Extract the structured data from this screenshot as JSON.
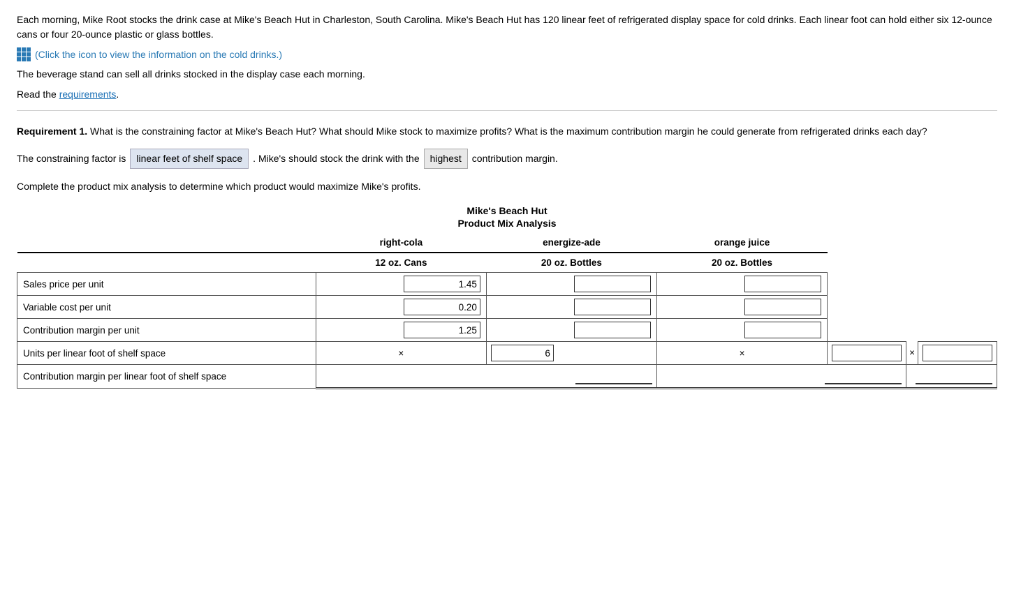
{
  "intro": {
    "paragraph": "Each morning, Mike Root stocks the drink case at Mike's Beach Hut in Charleston, South Carolina. Mike's Beach Hut has 120 linear feet of refrigerated display space for cold drinks. Each linear foot can hold either six 12-ounce cans or four 20-ounce plastic or glass bottles.",
    "click_note": "(Click the icon to view the information on the cold drinks.)",
    "beverage": "The beverage stand can sell all drinks stocked in the display case each morning.",
    "read_req_prefix": "Read the ",
    "read_req_link": "requirements",
    "read_req_suffix": "."
  },
  "requirement1": {
    "label": "Requirement 1.",
    "text": " What is the constraining factor at Mike's Beach Hut? What should Mike stock to maximize profits? What is the maximum contribution margin he could generate from refrigerated drinks each day?",
    "constraining_prefix": "The constraining factor is",
    "constraining_value": "linear feet of shelf space",
    "constraining_mid": ". Mike's should stock the drink with the",
    "constraining_highlight": "highest",
    "constraining_suffix": "contribution margin.",
    "complete_text": "Complete the product mix analysis to determine which product would maximize Mike's profits."
  },
  "table": {
    "title": "Mike's Beach Hut",
    "subtitle": "Product Mix Analysis",
    "columns": [
      {
        "name": "right-cola",
        "sub": "12 oz. Cans"
      },
      {
        "name": "energize-ade",
        "sub": "20 oz. Bottles"
      },
      {
        "name": "orange juice",
        "sub": "20 oz. Bottles"
      }
    ],
    "rows": [
      {
        "label": "Sales price per unit",
        "values": [
          "1.45",
          "",
          ""
        ],
        "prefix": [
          "",
          "",
          ""
        ],
        "suffix": [
          "",
          "",
          ""
        ]
      },
      {
        "label": "Variable cost per unit",
        "values": [
          "0.20",
          "",
          ""
        ],
        "prefix": [
          "",
          "",
          ""
        ],
        "suffix": [
          "",
          "",
          ""
        ]
      },
      {
        "label": "Contribution margin per unit",
        "values": [
          "1.25",
          "",
          ""
        ],
        "prefix": [
          "",
          "",
          ""
        ],
        "suffix": [
          "",
          "",
          ""
        ]
      },
      {
        "label": "Units per linear foot of shelf space",
        "values": [
          "6",
          "",
          ""
        ],
        "prefix": [
          "×",
          "×",
          "×"
        ],
        "suffix": [
          "",
          "",
          ""
        ]
      },
      {
        "label": "Contribution margin per linear foot of shelf space",
        "values": [
          "",
          "",
          ""
        ],
        "prefix": [
          "",
          "",
          ""
        ],
        "suffix": [
          "",
          "",
          ""
        ],
        "double_underline": true
      }
    ]
  }
}
